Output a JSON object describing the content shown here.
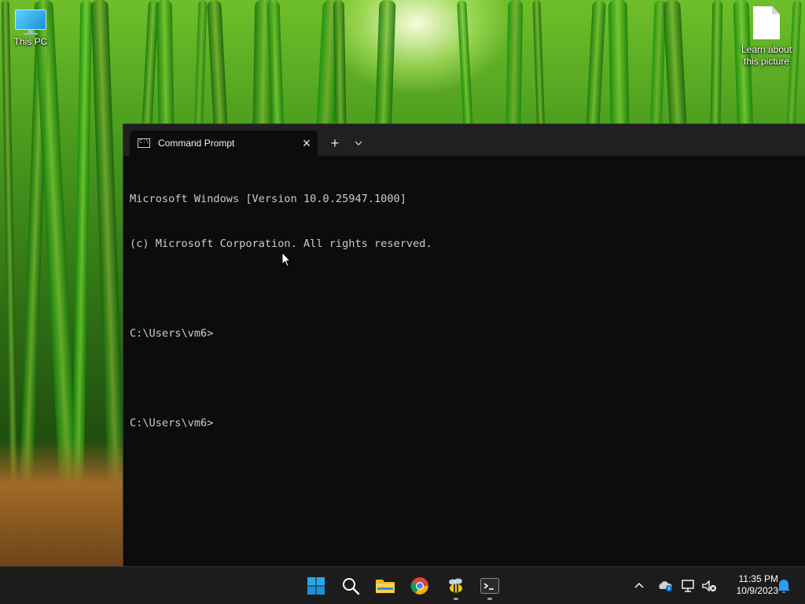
{
  "desktop": {
    "icons": [
      {
        "label": "This PC",
        "icon": "this-pc-icon"
      },
      {
        "label": "Learn about this picture",
        "icon": "document-icon"
      }
    ]
  },
  "terminal": {
    "tab_title": "Command Prompt",
    "tab_icon": "cmd-icon",
    "new_tab_label": "+",
    "close_label": "✕",
    "lines": [
      "Microsoft Windows [Version 10.0.25947.1000]",
      "(c) Microsoft Corporation. All rights reserved.",
      "",
      "C:\\Users\\vm6>",
      "",
      "C:\\Users\\vm6>"
    ]
  },
  "taskbar": {
    "apps": [
      {
        "name": "start",
        "icon": "windows-logo-icon"
      },
      {
        "name": "search",
        "icon": "search-icon"
      },
      {
        "name": "file-explorer",
        "icon": "folder-icon"
      },
      {
        "name": "chrome",
        "icon": "chrome-icon"
      },
      {
        "name": "bee-app",
        "icon": "bee-icon",
        "running": true
      },
      {
        "name": "terminal",
        "icon": "terminal-icon",
        "running": true
      }
    ],
    "tray": {
      "icons": [
        "chevron-up-icon",
        "onedrive-icon",
        "network-icon",
        "volume-muted-icon",
        "bell-icon"
      ]
    },
    "clock": {
      "time": "11:35 PM",
      "date": "10/9/2023"
    }
  },
  "colors": {
    "terminal_bg": "#0c0c0c",
    "tabbar_bg": "#202020",
    "taskbar_bg": "#1c1c1c",
    "text": "#cccccc",
    "accent_blue": "#0078d4"
  }
}
